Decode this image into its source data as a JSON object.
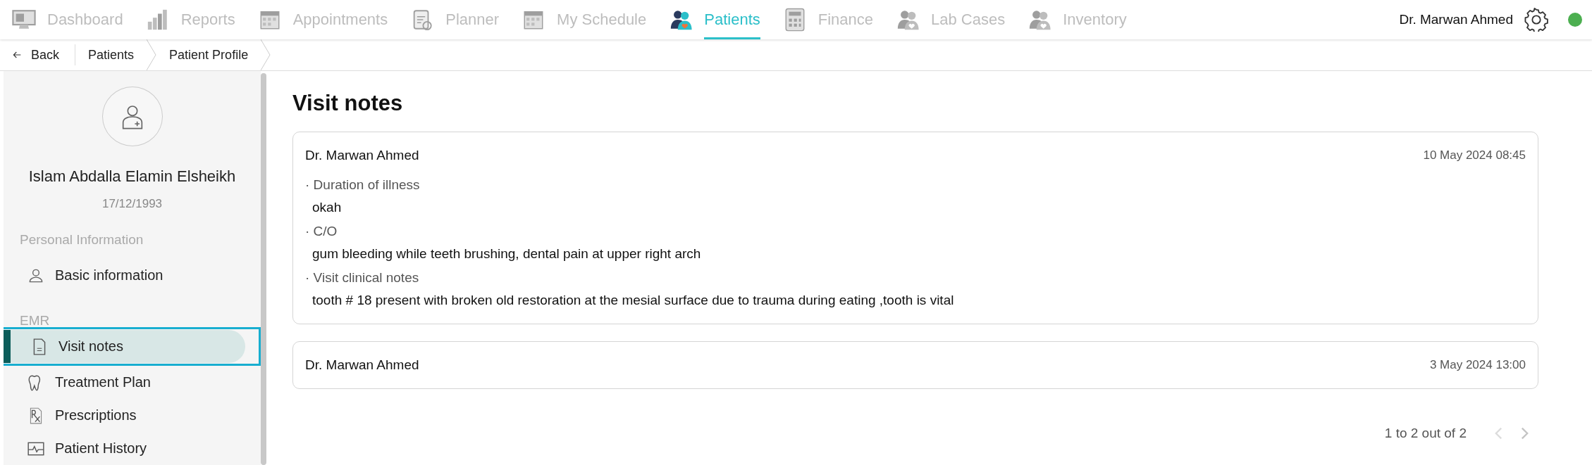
{
  "nav": {
    "items": [
      {
        "label": "Dashboard",
        "selected": false
      },
      {
        "label": "Reports",
        "selected": false
      },
      {
        "label": "Appointments",
        "selected": false
      },
      {
        "label": "Planner",
        "selected": false
      },
      {
        "label": "My Schedule",
        "selected": false
      },
      {
        "label": "Patients",
        "selected": true
      },
      {
        "label": "Finance",
        "selected": false
      },
      {
        "label": "Lab Cases",
        "selected": false
      },
      {
        "label": "Inventory",
        "selected": false
      }
    ],
    "user": {
      "name": "Dr. Marwan Ahmed",
      "online": true
    }
  },
  "breadcrumb": {
    "back": "Back",
    "crumbs": [
      "Patients",
      "Patient Profile"
    ]
  },
  "sidebar": {
    "patient": {
      "name": "Islam Abdalla Elamin Elsheikh",
      "birth_date": "17/12/1993"
    },
    "sections": [
      {
        "heading": "Personal Information",
        "items": [
          {
            "label": "Basic information",
            "selected": false,
            "focused": false
          }
        ]
      },
      {
        "heading": "EMR",
        "items": [
          {
            "label": "Visit notes",
            "selected": true,
            "focused": true
          },
          {
            "label": "Treatment Plan",
            "selected": false,
            "focused": false
          },
          {
            "label": "Prescriptions",
            "selected": false,
            "focused": false
          },
          {
            "label": "Patient History",
            "selected": false,
            "focused": false
          }
        ]
      }
    ]
  },
  "content": {
    "title": "Visit notes",
    "notes": [
      {
        "author": "Dr. Marwan Ahmed",
        "date": "10 May 2024 08:45",
        "fields": [
          {
            "label": "· Duration of illness",
            "value": "okah"
          },
          {
            "label": "· C/O",
            "value": "gum bleeding while teeth brushing, dental pain at upper right arch"
          },
          {
            "label": "· Visit clinical notes",
            "value": "tooth # 18 present with broken old restoration at the mesial surface due to trauma during eating ,tooth is vital"
          }
        ]
      },
      {
        "author": "Dr. Marwan Ahmed",
        "date": "3 May 2024 13:00"
      }
    ],
    "pagination": {
      "text": "1 to 2 out of 2",
      "prev_disabled": true,
      "next_disabled": false
    }
  }
}
